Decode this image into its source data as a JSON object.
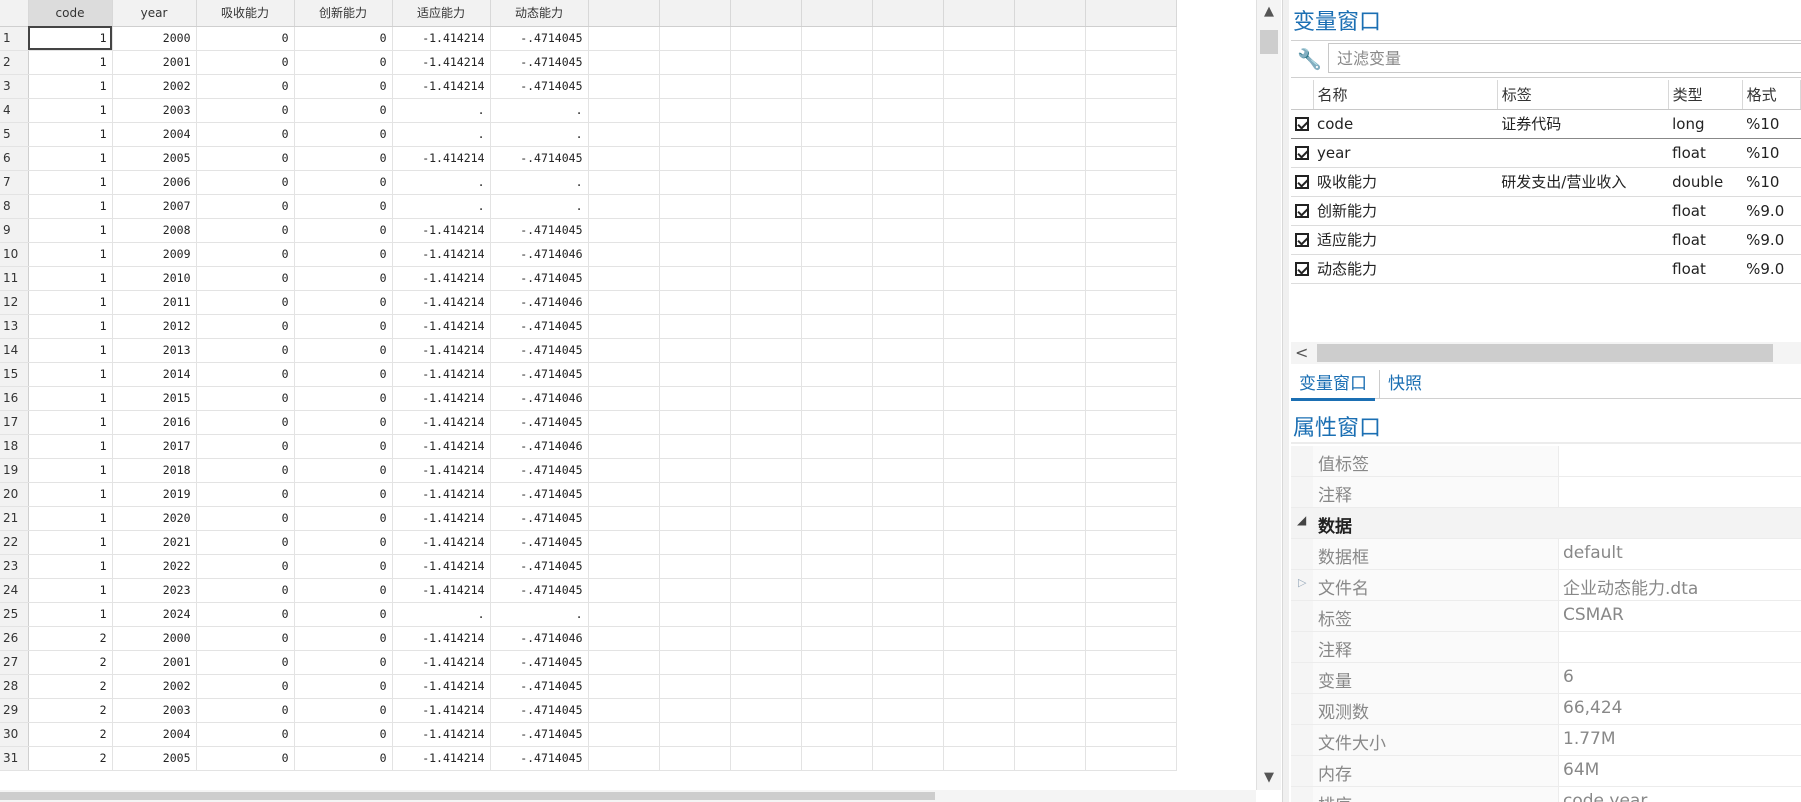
{
  "grid": {
    "columns": [
      "code",
      "year",
      "吸收能力",
      "创新能力",
      "适应能力",
      "动态能力"
    ],
    "rows": [
      [
        "1",
        "1",
        "2000",
        "0",
        "0",
        "-1.414214",
        "-.4714045"
      ],
      [
        "2",
        "1",
        "2001",
        "0",
        "0",
        "-1.414214",
        "-.4714045"
      ],
      [
        "3",
        "1",
        "2002",
        "0",
        "0",
        "-1.414214",
        "-.4714045"
      ],
      [
        "4",
        "1",
        "2003",
        "0",
        "0",
        ".",
        "."
      ],
      [
        "5",
        "1",
        "2004",
        "0",
        "0",
        ".",
        "."
      ],
      [
        "6",
        "1",
        "2005",
        "0",
        "0",
        "-1.414214",
        "-.4714045"
      ],
      [
        "7",
        "1",
        "2006",
        "0",
        "0",
        ".",
        "."
      ],
      [
        "8",
        "1",
        "2007",
        "0",
        "0",
        ".",
        "."
      ],
      [
        "9",
        "1",
        "2008",
        "0",
        "0",
        "-1.414214",
        "-.4714045"
      ],
      [
        "10",
        "1",
        "2009",
        "0",
        "0",
        "-1.414214",
        "-.4714046"
      ],
      [
        "11",
        "1",
        "2010",
        "0",
        "0",
        "-1.414214",
        "-.4714045"
      ],
      [
        "12",
        "1",
        "2011",
        "0",
        "0",
        "-1.414214",
        "-.4714046"
      ],
      [
        "13",
        "1",
        "2012",
        "0",
        "0",
        "-1.414214",
        "-.4714045"
      ],
      [
        "14",
        "1",
        "2013",
        "0",
        "0",
        "-1.414214",
        "-.4714045"
      ],
      [
        "15",
        "1",
        "2014",
        "0",
        "0",
        "-1.414214",
        "-.4714045"
      ],
      [
        "16",
        "1",
        "2015",
        "0",
        "0",
        "-1.414214",
        "-.4714046"
      ],
      [
        "17",
        "1",
        "2016",
        "0",
        "0",
        "-1.414214",
        "-.4714045"
      ],
      [
        "18",
        "1",
        "2017",
        "0",
        "0",
        "-1.414214",
        "-.4714046"
      ],
      [
        "19",
        "1",
        "2018",
        "0",
        "0",
        "-1.414214",
        "-.4714045"
      ],
      [
        "20",
        "1",
        "2019",
        "0",
        "0",
        "-1.414214",
        "-.4714045"
      ],
      [
        "21",
        "1",
        "2020",
        "0",
        "0",
        "-1.414214",
        "-.4714045"
      ],
      [
        "22",
        "1",
        "2021",
        "0",
        "0",
        "-1.414214",
        "-.4714045"
      ],
      [
        "23",
        "1",
        "2022",
        "0",
        "0",
        "-1.414214",
        "-.4714045"
      ],
      [
        "24",
        "1",
        "2023",
        "0",
        "0",
        "-1.414214",
        "-.4714045"
      ],
      [
        "25",
        "1",
        "2024",
        "0",
        "0",
        ".",
        "."
      ],
      [
        "26",
        "2",
        "2000",
        "0",
        "0",
        "-1.414214",
        "-.4714046"
      ],
      [
        "27",
        "2",
        "2001",
        "0",
        "0",
        "-1.414214",
        "-.4714045"
      ],
      [
        "28",
        "2",
        "2002",
        "0",
        "0",
        "-1.414214",
        "-.4714045"
      ],
      [
        "29",
        "2",
        "2003",
        "0",
        "0",
        "-1.414214",
        "-.4714045"
      ],
      [
        "30",
        "2",
        "2004",
        "0",
        "0",
        "-1.414214",
        "-.4714045"
      ],
      [
        "31",
        "2",
        "2005",
        "0",
        "0",
        "-1.414214",
        "-.4714045"
      ]
    ]
  },
  "variables": {
    "title": "变量窗口",
    "filter_placeholder": "过滤变量",
    "headers": [
      "名称",
      "标签",
      "类型",
      "格式"
    ],
    "rows": [
      [
        "code",
        "证券代码",
        "long",
        "%10"
      ],
      [
        "year",
        "",
        "float",
        "%10"
      ],
      [
        "吸收能力",
        "研发支出/营业收入",
        "double",
        "%10"
      ],
      [
        "创新能力",
        "",
        "float",
        "%9.0"
      ],
      [
        "适应能力",
        "",
        "float",
        "%9.0"
      ],
      [
        "动态能力",
        "",
        "float",
        "%9.0"
      ]
    ]
  },
  "tabs": [
    "变量窗口",
    "快照"
  ],
  "properties": {
    "title": "属性窗口",
    "rows": [
      {
        "k": "值标签",
        "v": ""
      },
      {
        "k": "注释",
        "v": ""
      },
      {
        "k": "数据",
        "v": "",
        "section": true
      },
      {
        "k": "数据框",
        "v": "default"
      },
      {
        "k": "文件名",
        "v": "企业动态能力.dta",
        "expand": true
      },
      {
        "k": "标签",
        "v": "CSMAR"
      },
      {
        "k": "注释",
        "v": ""
      },
      {
        "k": "变量",
        "v": "6"
      },
      {
        "k": "观测数",
        "v": "66,424"
      },
      {
        "k": "文件大小",
        "v": "1.77M"
      },
      {
        "k": "内存",
        "v": "64M"
      },
      {
        "k": "排序",
        "v": "code year"
      }
    ]
  },
  "icons": {
    "scroll_up": "▲",
    "scroll_down": "▼",
    "scroll_left": "<",
    "wrench": "🔧",
    "collapse": "◢",
    "expand": "▷"
  }
}
